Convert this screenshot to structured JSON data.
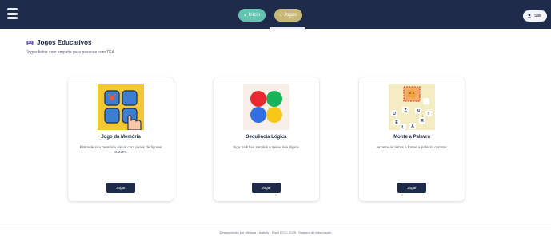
{
  "navbar": {
    "menu_icon": "hamburger-menu-icon",
    "tabs": [
      {
        "label": "Início",
        "icon": "home-icon",
        "color": "#62c4b0"
      },
      {
        "label": "Jogos",
        "icon": "gamepad-icon",
        "color": "#c8b878"
      }
    ],
    "logout": {
      "label": "Sair",
      "icon": "user-icon"
    }
  },
  "page": {
    "title": "Jogos Educativos",
    "title_icon": "gamepad-icon",
    "subtitle": "Jogos feitos com empatia para pessoas com TEA"
  },
  "games": [
    {
      "title": "Jogo da Memória",
      "description": "Estimule sua memória visual com pares de figuras suaves.",
      "button": "Jogar",
      "thumbnail": "memory-game-icon"
    },
    {
      "title": "Sequência Lógica",
      "description": "Siga padrões simples e treine sua lógica.",
      "button": "Jogar",
      "thumbnail": "colored-circles-icon"
    },
    {
      "title": "Monte a Palavra",
      "description": "Arraste as letras e forme a palavra correta!",
      "button": "Jogar",
      "thumbnail": "word-tiles-icon",
      "thumbnail_letters": [
        "U",
        "Z",
        "N",
        "T",
        "E",
        "R",
        "L",
        "A"
      ]
    }
  ],
  "footer": {
    "text": "Desenvolvido por Melissa - Isabely - Emili | TCC 2025 | Sistema de Informação"
  },
  "colors": {
    "navbar": "#1e2b4a",
    "home_pill": "#62c4b0",
    "games_pill": "#c8b878",
    "button": "#1e2b4a",
    "memory_bg": "#f2c737",
    "memory_tile": "#3b7fd1",
    "circle_red": "#e8292f",
    "circle_green": "#18b356",
    "circle_blue": "#2f6fe0",
    "circle_yellow": "#f6c81a",
    "word_bg": "#f4ecc2"
  }
}
